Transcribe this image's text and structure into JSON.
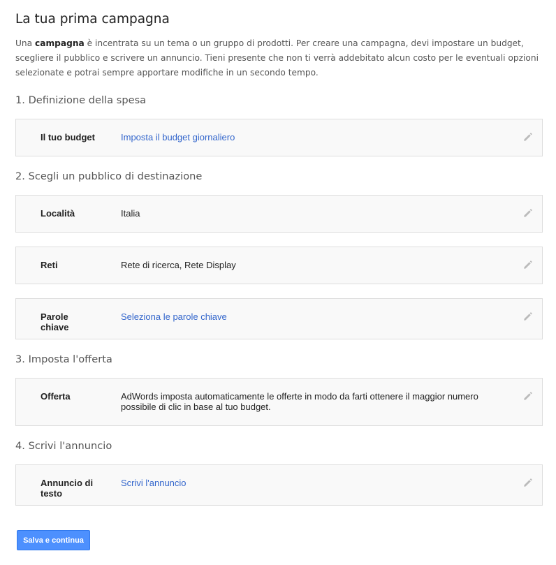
{
  "page": {
    "title": "La tua prima campagna",
    "intro": {
      "prefix": "Una ",
      "bold": "campagna",
      "suffix": " è incentrata su un tema o un gruppo di prodotti. Per creare una campagna, devi impostare un budget, scegliere il pubblico e scrivere un annuncio. Tieni presente che non ti verrà addebitato alcun costo per le eventuali opzioni selezionate e potrai sempre apportare modifiche in un secondo tempo."
    }
  },
  "sections": {
    "spend": {
      "title": "1. Definizione della spesa",
      "budget": {
        "label": "Il tuo budget",
        "value": "Imposta il budget giornaliero"
      }
    },
    "audience": {
      "title": "2. Scegli un pubblico di destinazione",
      "location": {
        "label": "Località",
        "value": "Italia"
      },
      "networks": {
        "label": "Reti",
        "value": "Rete di ricerca, Rete Display"
      },
      "keywords": {
        "label": "Parole chiave",
        "value": "Seleziona le parole chiave"
      }
    },
    "bid": {
      "title": "3. Imposta l'offerta",
      "offer": {
        "label": "Offerta",
        "value": "AdWords imposta automaticamente le offerte in modo da farti ottenere il maggior numero possibile di clic in base al tuo budget."
      }
    },
    "ad": {
      "title": "4. Scrivi l'annuncio",
      "text_ad": {
        "label": "Annuncio di testo",
        "value": "Scrivi l'annuncio"
      }
    }
  },
  "actions": {
    "save_label": "Salva e continua"
  },
  "colors": {
    "link": "#3366cc",
    "button": "#4d90fe",
    "card_background": "#f9f9f9",
    "card_border": "#dddddd"
  },
  "icons": {
    "edit": "pencil-icon"
  }
}
